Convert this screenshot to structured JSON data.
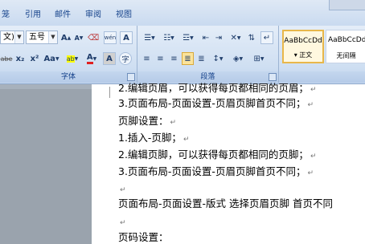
{
  "menu": {
    "tabs": [
      "笼",
      "引用",
      "邮件",
      "审阅",
      "视图"
    ]
  },
  "ribbon": {
    "font": {
      "family_value": "文)",
      "size_value": "五号",
      "group_label": "字体",
      "grow_label": "A",
      "shrink_label": "A",
      "phonetic_label": "wén",
      "charborder_label": "A",
      "strike_label": "abe",
      "sub_label": "x₂",
      "sup_label": "x²",
      "case_label": "Aa",
      "highlight_label": "ab",
      "fontcolor_label": "A",
      "shade_label": "A",
      "enclose_label": "字"
    },
    "paragraph": {
      "group_label": "段落"
    },
    "styles": {
      "items": [
        {
          "preview": "AaBbCcDd",
          "name": "▾ 正文"
        },
        {
          "preview": "AaBbCcDd",
          "name": "无间隔"
        }
      ]
    }
  },
  "document": {
    "lines": [
      "2.编辑页眉，可以获得每页都相同的页眉；",
      "3.页面布局-页面设置-页眉页脚首页不同；",
      "页脚设置：",
      "1.插入-页脚；",
      "2.编辑页脚，可以获得每页都相同的页脚；",
      "3.页面布局-页面设置-页眉页脚首页不同；",
      "",
      "页面布局-页面设置-版式   选择页眉页脚  首页不同",
      "",
      "页码设置："
    ],
    "return_mark": "↵"
  },
  "colors": {
    "ribbon_bg": "#cfdff2",
    "tab_text": "#15428b",
    "highlight_yellow": "#ffff00",
    "font_red": "#e02020",
    "selected_style_border": "#e8b74a"
  }
}
